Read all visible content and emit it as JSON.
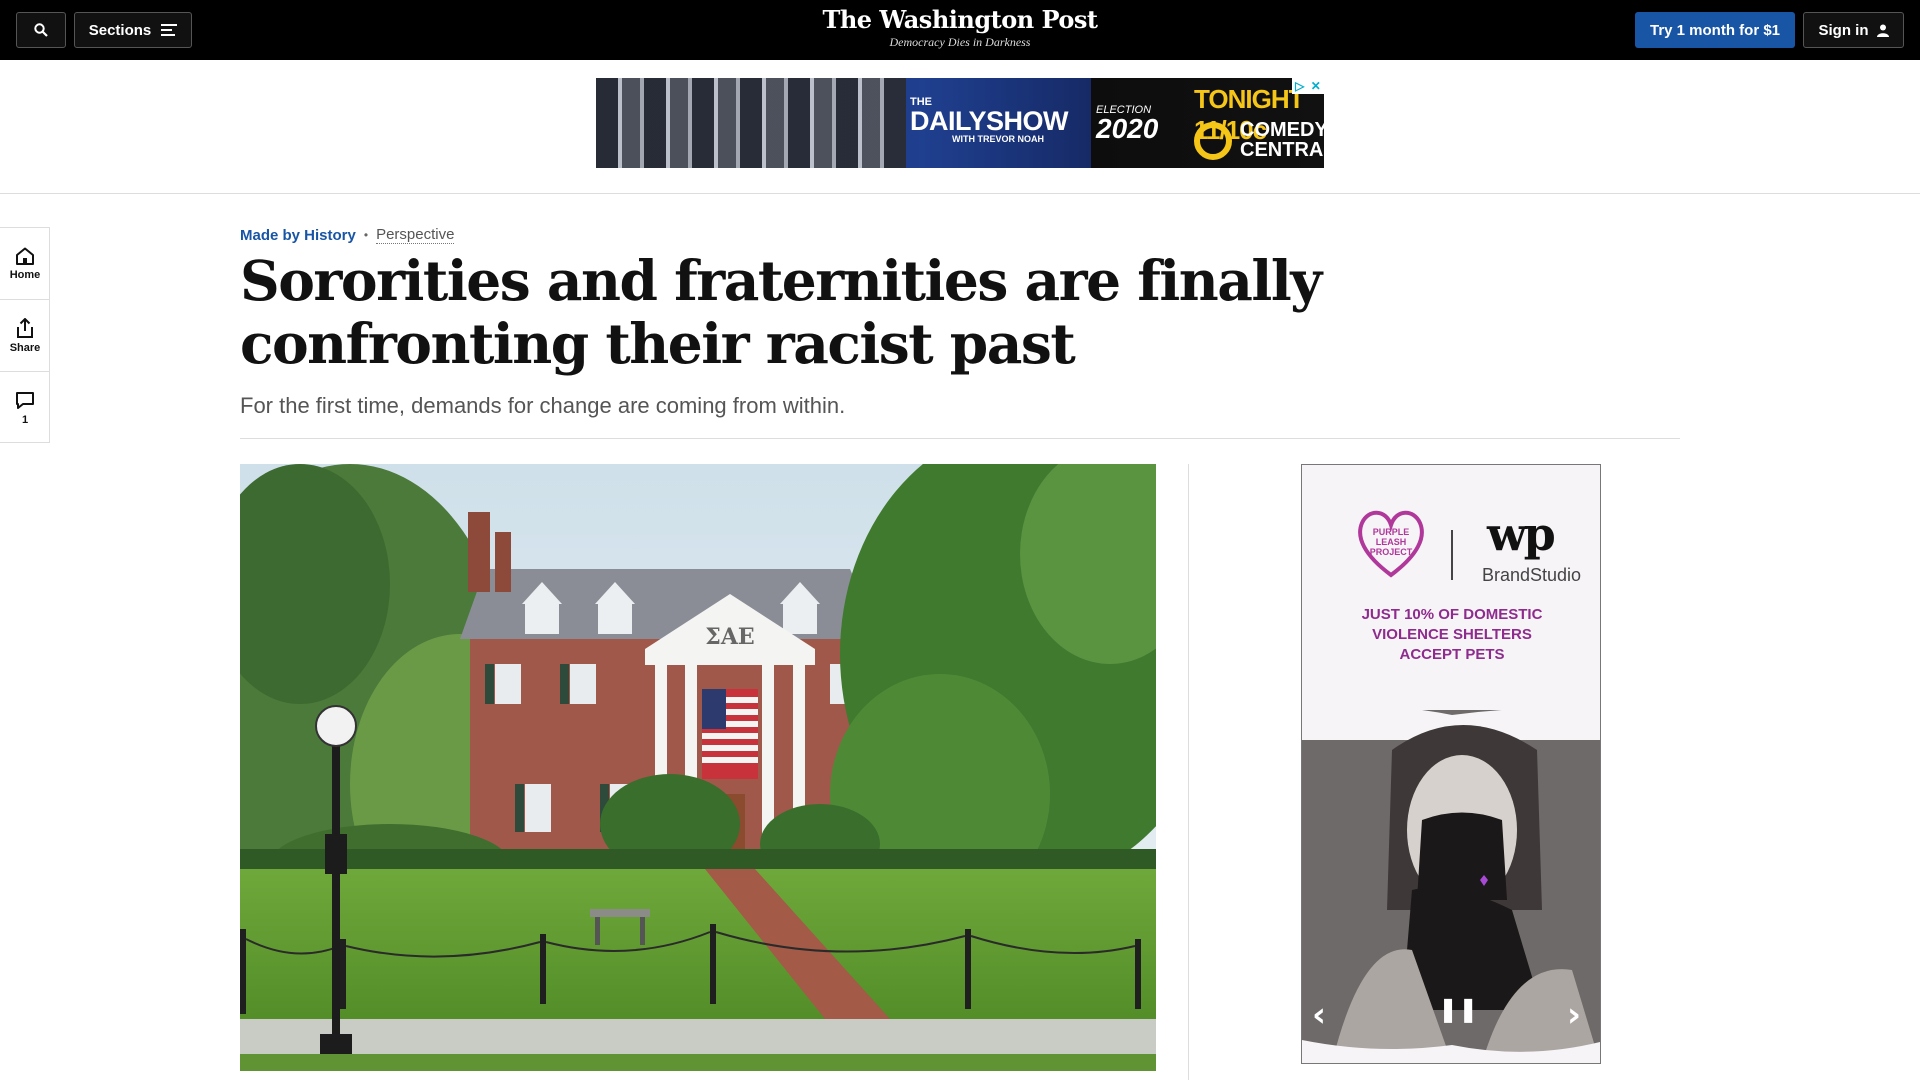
{
  "nav": {
    "sections_label": "Sections",
    "masthead": "The Washington Post",
    "tagline": "Democracy Dies in Darkness",
    "subscribe_label": "Try 1 month for $1",
    "signin_label": "Sign in"
  },
  "top_ad": {
    "the": "THE",
    "show": "DAILYSHOW",
    "with": "WITH TREVOR NOAH",
    "election": "ELECTION",
    "year": "2020",
    "tonight": "TONIGHT 11/10c",
    "network_line1": "COMEDY",
    "network_line2": "CENTRAL"
  },
  "rail": {
    "home_label": "Home",
    "share_label": "Share",
    "comments_count": "1"
  },
  "article": {
    "section": "Made by History",
    "label": "Perspective",
    "headline": "Sororities and fraternities are finally confronting their racist past",
    "dek": "For the first time, demands for change are coming from within."
  },
  "photo": {
    "letters": "ΣΑΕ"
  },
  "side_ad": {
    "logo_left_line1": "PURPLE",
    "logo_left_line2": "LEASH",
    "logo_left_line3": "PROJECT",
    "logo_right": "wp",
    "brand": "BrandStudio",
    "copy_line1": "JUST 10% OF DOMESTIC",
    "copy_line2": "VIOLENCE SHELTERS",
    "copy_line3": "ACCEPT PETS"
  },
  "colors": {
    "nav_bg": "#000000",
    "accent_blue": "#1955a5",
    "ad_purple": "#8e2c8e"
  }
}
